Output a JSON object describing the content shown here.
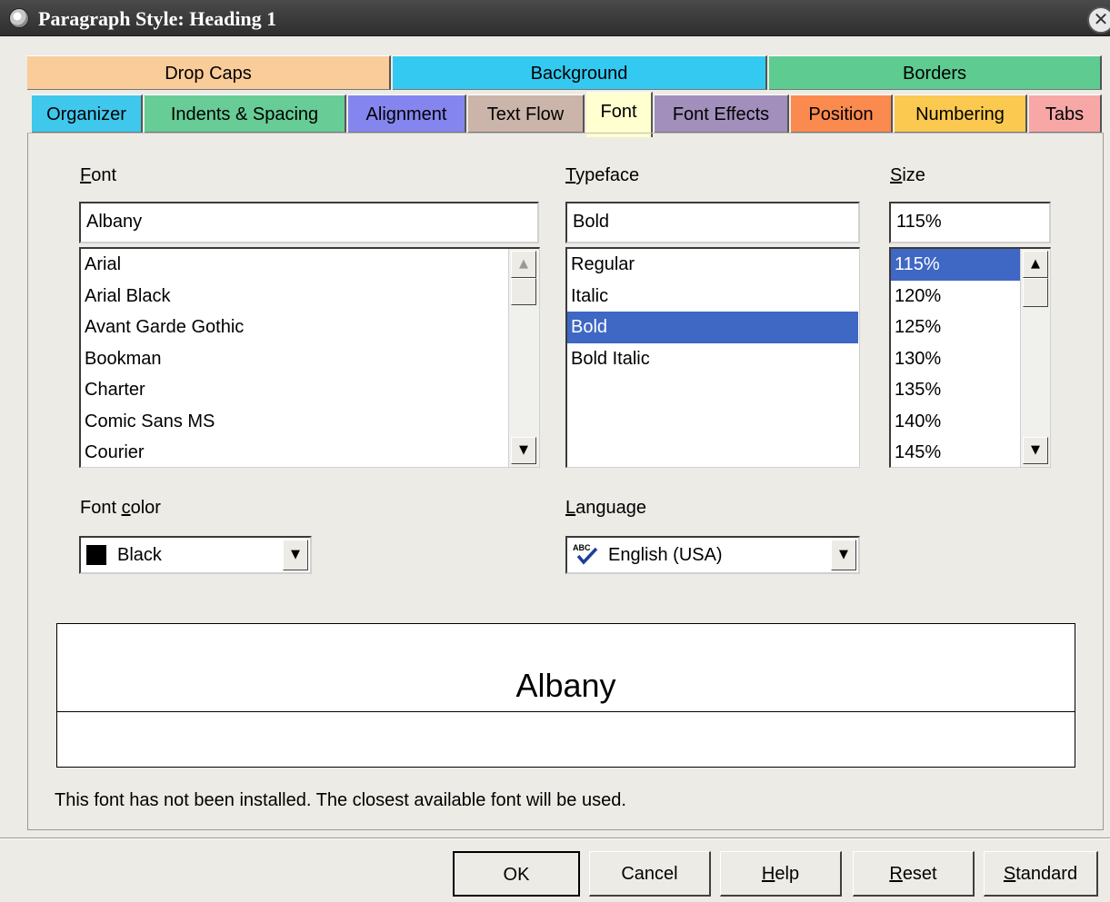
{
  "window": {
    "title": "Paragraph Style: Heading 1"
  },
  "tabs": {
    "row1": [
      "Drop Caps",
      "Background",
      "Borders"
    ],
    "row2": [
      "Organizer",
      "Indents & Spacing",
      "Alignment",
      "Text Flow",
      "Font",
      "Font Effects",
      "Position",
      "Numbering",
      "Tabs"
    ],
    "active": "Font",
    "colors": {
      "Drop Caps": "#f9cc99",
      "Background": "#34c9f0",
      "Borders": "#5ecb91",
      "Organizer": "#40c7ec",
      "Indents & Spacing": "#67cc96",
      "Alignment": "#8585f0",
      "Text Flow": "#cbb4a9",
      "Font": "#ffffcf",
      "Font Effects": "#a28fbc",
      "Position": "#fb8a4f",
      "Numbering": "#fbc950",
      "Tabs": "#f8a7a7"
    }
  },
  "font": {
    "label_pre": "",
    "label_ul": "F",
    "label_post": "ont",
    "value": "Albany",
    "items": [
      "Arial",
      "Arial Black",
      "Avant Garde Gothic",
      "Bookman",
      "Charter",
      "Comic Sans MS",
      "Courier"
    ]
  },
  "typeface": {
    "label_pre": "",
    "label_ul": "T",
    "label_post": "ypeface",
    "value": "Bold",
    "items": [
      "Regular",
      "Italic",
      "Bold",
      "Bold Italic"
    ],
    "selected": "Bold"
  },
  "size": {
    "label_pre": "",
    "label_ul": "S",
    "label_post": "ize",
    "value": "115%",
    "items": [
      "115%",
      "120%",
      "125%",
      "130%",
      "135%",
      "140%",
      "145%"
    ],
    "selected": "115%"
  },
  "font_color": {
    "label_pre": "Font ",
    "label_ul": "c",
    "label_post": "olor",
    "value": "Black",
    "swatch": "#000000"
  },
  "language": {
    "label_pre": "",
    "label_ul": "L",
    "label_post": "anguage",
    "value": "English (USA)",
    "icon": "spellcheck-icon",
    "icon_text": "ABC"
  },
  "preview": {
    "text": "Albany"
  },
  "status": "This font has not been installed. The closest available font will be used.",
  "buttons": {
    "ok": "OK",
    "cancel": "Cancel",
    "help_ul": "H",
    "help_post": "elp",
    "reset_ul": "R",
    "reset_post": "eset",
    "standard_ul": "S",
    "standard_post": "tandard"
  }
}
